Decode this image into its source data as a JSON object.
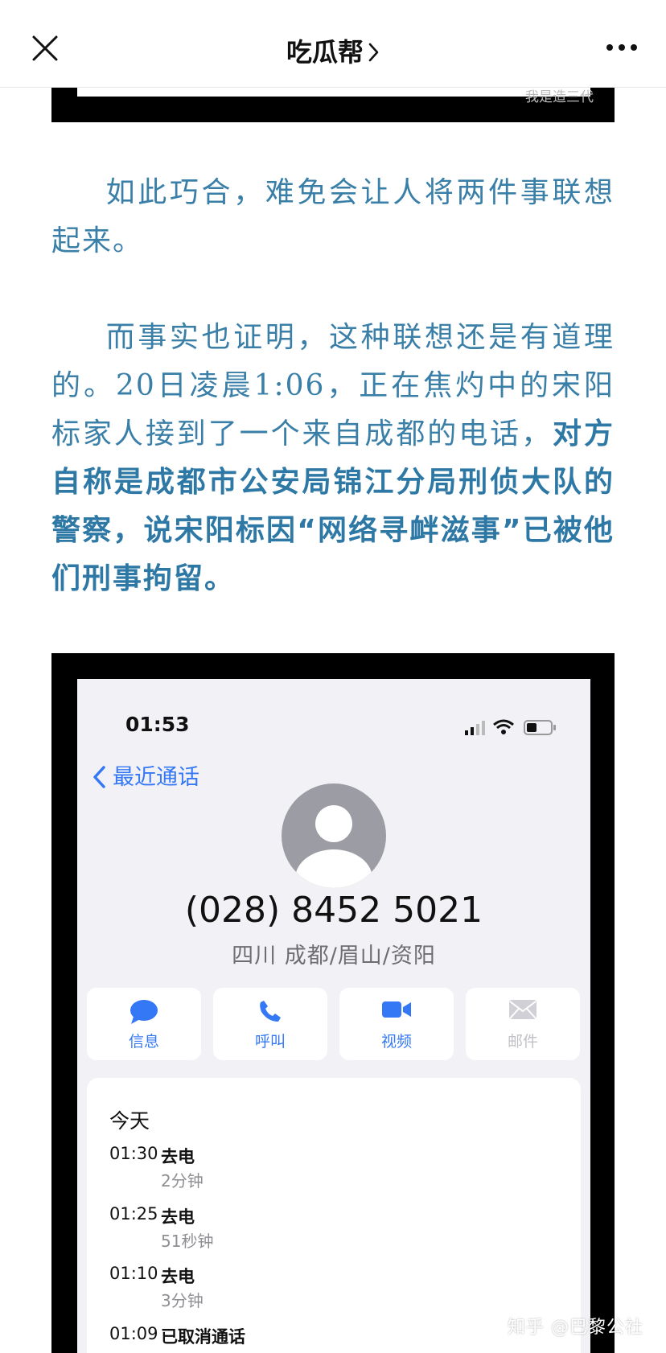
{
  "navbar": {
    "title": "吃瓜帮",
    "close_icon": "close-icon",
    "chevron_icon": "chevron-right-icon",
    "more_icon": "more-dots-icon"
  },
  "top_image": {
    "watermark": "我是造三代"
  },
  "article": {
    "paragraph1": "如此巧合，难免会让人将两件事联想起来。",
    "paragraph2_plain": "而事实也证明，这种联想还是有道理的。20日凌晨1:06，正在焦灼中的宋阳标家人接到了一个来自成都的电话，",
    "paragraph2_bold": "对方自称是成都市公安局锦江分局刑侦大队的警察，说宋阳标因“网络寻衅滋事”已被他们刑事拘留。"
  },
  "phone_screenshot": {
    "status_time": "01:53",
    "back_label": "最近通话",
    "number": "(028) 8452 5021",
    "location": "四川 成都/眉山/资阳",
    "actions": [
      {
        "label": "信息",
        "icon": "message-icon",
        "enabled": true
      },
      {
        "label": "呼叫",
        "icon": "phone-icon",
        "enabled": true
      },
      {
        "label": "视频",
        "icon": "video-icon",
        "enabled": true
      },
      {
        "label": "邮件",
        "icon": "mail-icon",
        "enabled": false
      }
    ],
    "calls_header": "今天",
    "calls": [
      {
        "time": "01:30",
        "type": "去电",
        "duration": "2分钟"
      },
      {
        "time": "01:25",
        "type": "去电",
        "duration": "51秒钟"
      },
      {
        "time": "01:10",
        "type": "去电",
        "duration": "3分钟"
      },
      {
        "time": "01:09",
        "type": "已取消通话",
        "duration": ""
      }
    ],
    "colors": {
      "accent": "#3478f6",
      "screen_bg": "#f2f2f6"
    }
  },
  "watermark": "知乎 @巴黎公社",
  "colors": {
    "article_text": "#3a7fa8"
  }
}
